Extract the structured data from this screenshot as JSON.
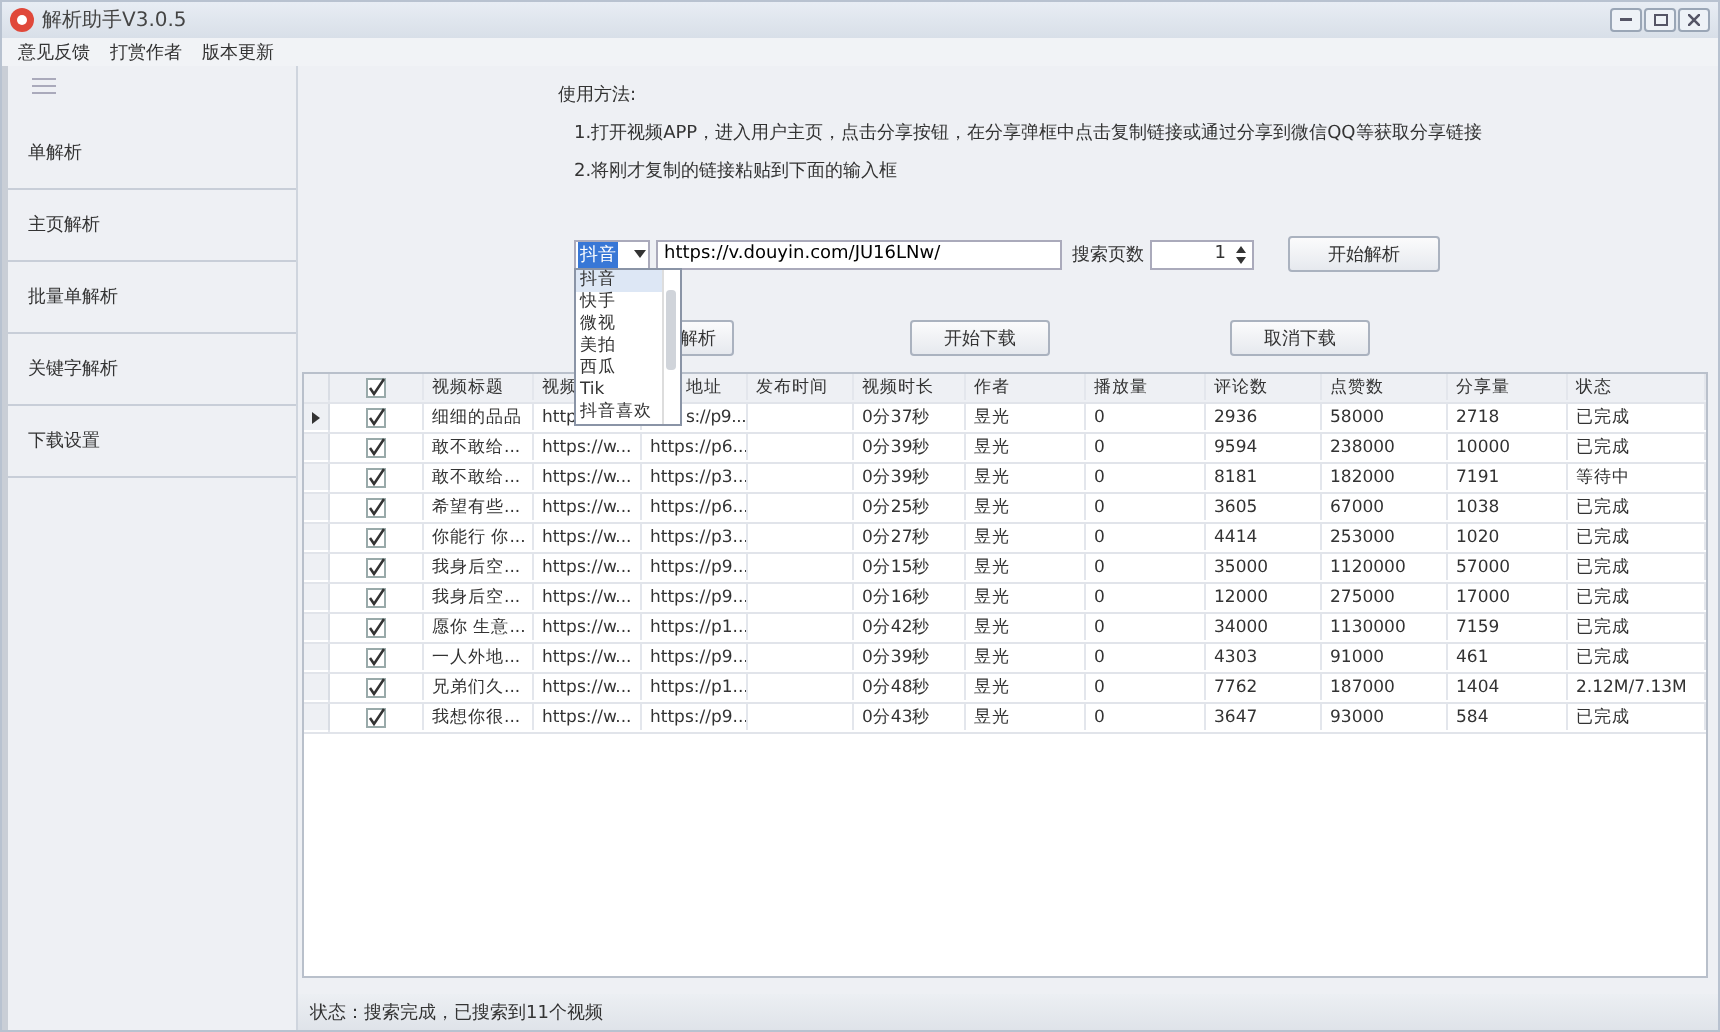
{
  "window": {
    "title": "解析助手V3.0.5"
  },
  "menu": [
    "意见反馈",
    "打赏作者",
    "版本更新"
  ],
  "sidebar": {
    "items": [
      {
        "label": "单解析",
        "selected": false
      },
      {
        "label": "主页解析",
        "selected": false
      },
      {
        "label": "批量单解析",
        "selected": false
      },
      {
        "label": "关键字解析",
        "selected": false
      },
      {
        "label": "下载设置",
        "selected": false
      }
    ]
  },
  "instructions": {
    "heading": "使用方法:",
    "steps": [
      "1.打开视频APP，进入用户主页，点击分享按钮，在分享弹框中点击复制链接或通过分享到微信QQ等获取分享链接",
      "2.将刚才复制的链接粘贴到下面的输入框"
    ]
  },
  "platform": {
    "value": "抖音",
    "expanded": true,
    "options": [
      {
        "label": "抖音",
        "selected": true
      },
      {
        "label": "快手",
        "selected": false
      },
      {
        "label": "微视",
        "selected": false
      },
      {
        "label": "美拍",
        "selected": false
      },
      {
        "label": "西瓜",
        "selected": false
      },
      {
        "label": "Tik",
        "selected": false
      },
      {
        "label": "抖音喜欢",
        "selected": false
      }
    ]
  },
  "url_field": {
    "value": "https://v.douyin.com/JU16LNw/"
  },
  "pages": {
    "label": "搜索页数",
    "value": "1"
  },
  "parse_button": "开始解析",
  "actions": [
    "解析",
    "开始下载",
    "取消下载"
  ],
  "table": {
    "all_checked": true,
    "columns": [
      "视频标题",
      "视频",
      "地址",
      "发布时间",
      "视频时长",
      "作者",
      "播放量",
      "评论数",
      "点赞数",
      "分享量",
      "状态"
    ],
    "rows": [
      {
        "current": true,
        "checked": true,
        "cells": [
          "细细的品品",
          "http",
          "s://p9...",
          "",
          "0分37秒",
          "昱光",
          "0",
          "2936",
          "58000",
          "2718",
          "已完成"
        ]
      },
      {
        "current": false,
        "checked": true,
        "cells": [
          "敢不敢给...",
          "https://w...",
          "https://p6...",
          "",
          "0分39秒",
          "昱光",
          "0",
          "9594",
          "238000",
          "10000",
          "已完成"
        ]
      },
      {
        "current": false,
        "checked": true,
        "cells": [
          "敢不敢给...",
          "https://w...",
          "https://p3...",
          "",
          "0分39秒",
          "昱光",
          "0",
          "8181",
          "182000",
          "7191",
          "等待中"
        ]
      },
      {
        "current": false,
        "checked": true,
        "cells": [
          "希望有些...",
          "https://w...",
          "https://p6...",
          "",
          "0分25秒",
          "昱光",
          "0",
          "3605",
          "67000",
          "1038",
          "已完成"
        ]
      },
      {
        "current": false,
        "checked": true,
        "cells": [
          "你能行 你...",
          "https://w...",
          "https://p3...",
          "",
          "0分27秒",
          "昱光",
          "0",
          "4414",
          "253000",
          "1020",
          "已完成"
        ]
      },
      {
        "current": false,
        "checked": true,
        "cells": [
          "我身后空...",
          "https://w...",
          "https://p9...",
          "",
          "0分15秒",
          "昱光",
          "0",
          "35000",
          "1120000",
          "57000",
          "已完成"
        ]
      },
      {
        "current": false,
        "checked": true,
        "cells": [
          "我身后空...",
          "https://w...",
          "https://p9...",
          "",
          "0分16秒",
          "昱光",
          "0",
          "12000",
          "275000",
          "17000",
          "已完成"
        ]
      },
      {
        "current": false,
        "checked": true,
        "cells": [
          "愿你 生意...",
          "https://w...",
          "https://p1...",
          "",
          "0分42秒",
          "昱光",
          "0",
          "34000",
          "1130000",
          "7159",
          "已完成"
        ]
      },
      {
        "current": false,
        "checked": true,
        "cells": [
          "一人外地...",
          "https://w...",
          "https://p9...",
          "",
          "0分39秒",
          "昱光",
          "0",
          "4303",
          "91000",
          "461",
          "已完成"
        ]
      },
      {
        "current": false,
        "checked": true,
        "cells": [
          "兄弟们久...",
          "https://w...",
          "https://p1...",
          "",
          "0分48秒",
          "昱光",
          "0",
          "7762",
          "187000",
          "1404",
          "2.12M/7.13M"
        ]
      },
      {
        "current": false,
        "checked": true,
        "cells": [
          "我想你很...",
          "https://w...",
          "https://p9...",
          "",
          "0分43秒",
          "昱光",
          "0",
          "3647",
          "93000",
          "584",
          "已完成"
        ]
      }
    ]
  },
  "status_bar": "状态：搜索完成，已搜索到11个视频"
}
